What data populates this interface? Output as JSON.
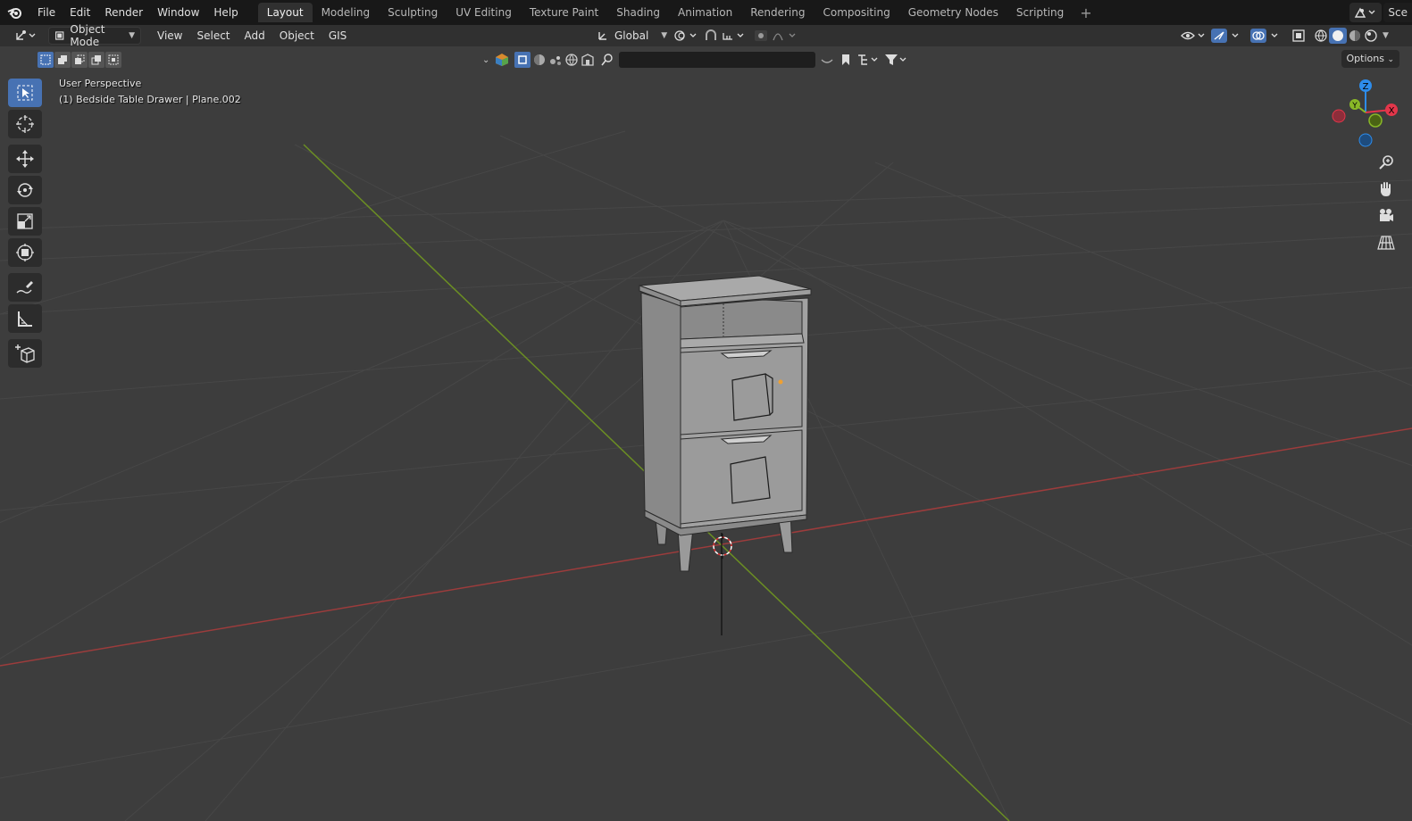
{
  "topbar": {
    "menus": [
      "File",
      "Edit",
      "Render",
      "Window",
      "Help"
    ],
    "workspaces": [
      "Layout",
      "Modeling",
      "Sculpting",
      "UV Editing",
      "Texture Paint",
      "Shading",
      "Animation",
      "Rendering",
      "Compositing",
      "Geometry Nodes",
      "Scripting"
    ],
    "active_workspace": "Layout",
    "add_label": "+",
    "scene_label": "Sce"
  },
  "header": {
    "mode_label": "Object Mode",
    "menus": [
      "View",
      "Select",
      "Add",
      "Object",
      "GIS"
    ],
    "transform_orientation": "Global"
  },
  "viewport": {
    "options_label": "Options",
    "view_name": "User Perspective",
    "object_info": "(1) Bedside Table Drawer | Plane.002",
    "search_placeholder": ""
  },
  "gizmo": {
    "axes": {
      "x": "X",
      "y": "Y",
      "z": "Z"
    },
    "colors": {
      "x": "#e3364a",
      "y": "#89b827",
      "z": "#2d8ceb"
    }
  },
  "colors": {
    "accent": "#4772b3",
    "viewport_bg": "#3d3d3d",
    "grid_line": "#454545",
    "x_axis": "#9c3c3c",
    "y_axis": "#6b8e23"
  }
}
